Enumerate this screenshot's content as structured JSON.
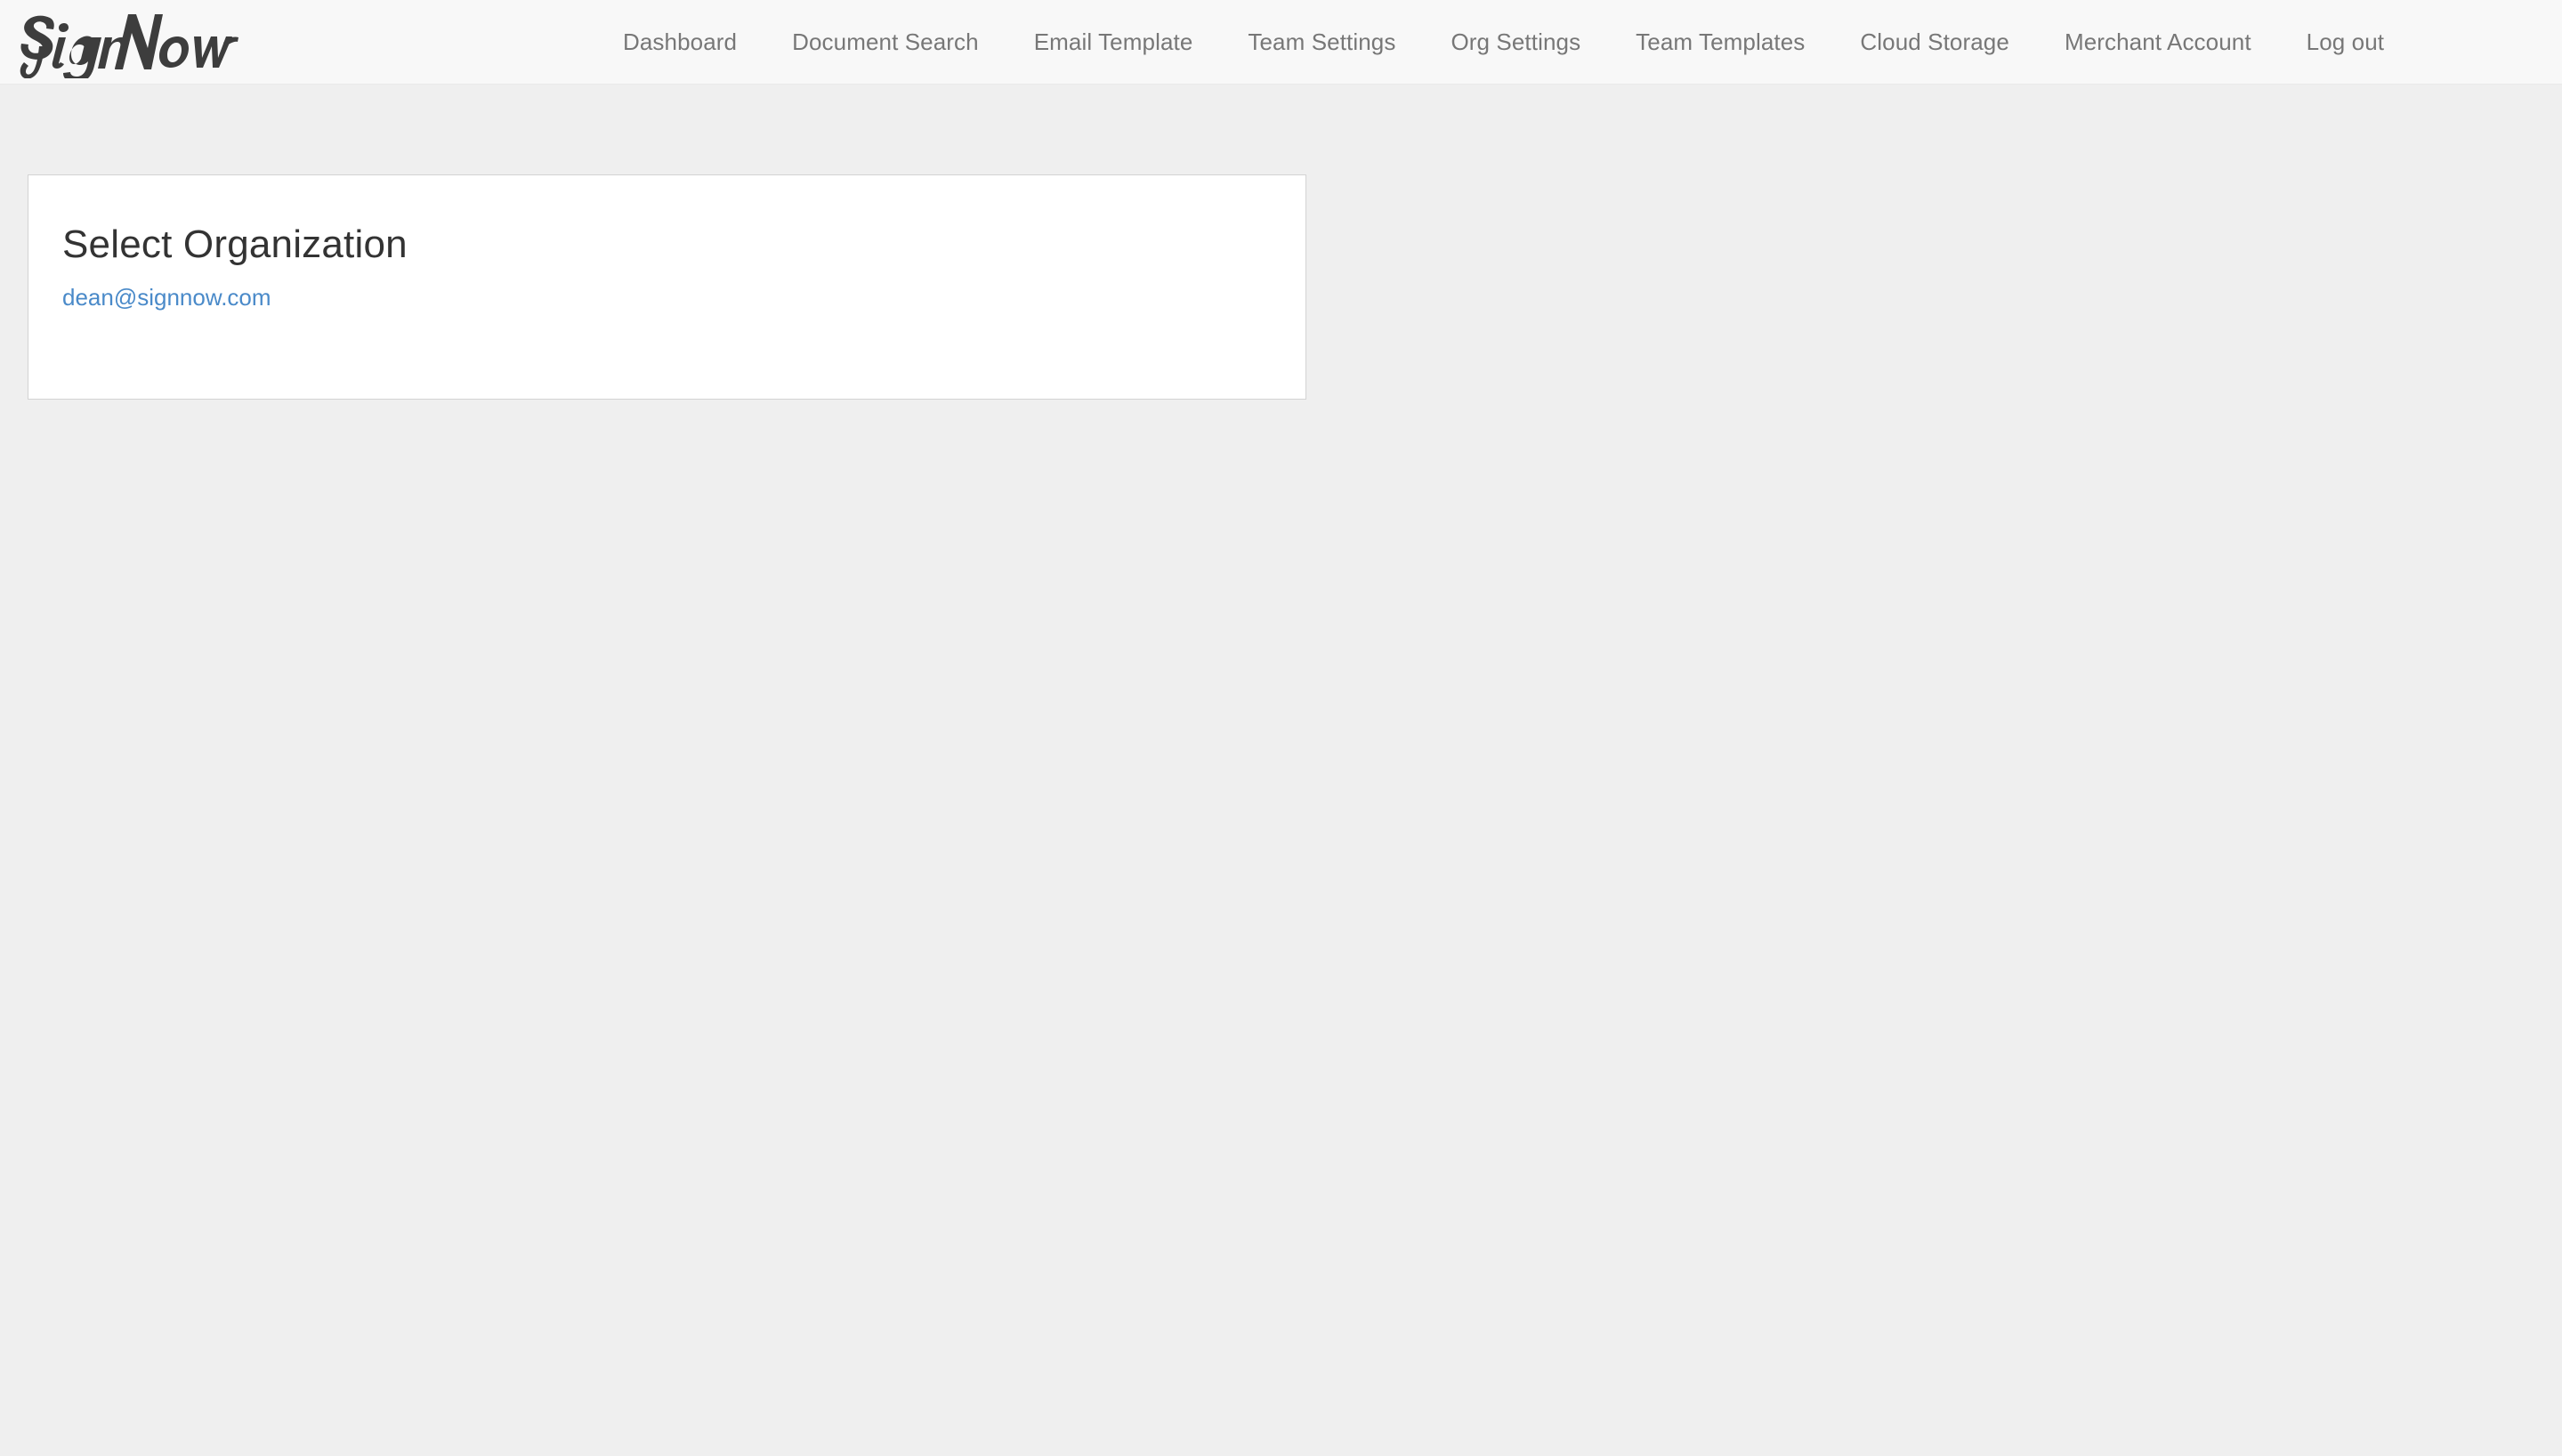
{
  "header": {
    "logo_text": "SignNow",
    "logo_icon": "signnow-script-logo",
    "nav_items": [
      {
        "label": "Dashboard",
        "name": "dashboard"
      },
      {
        "label": "Document Search",
        "name": "document-search"
      },
      {
        "label": "Email Template",
        "name": "email-template"
      },
      {
        "label": "Team Settings",
        "name": "team-settings"
      },
      {
        "label": "Org Settings",
        "name": "org-settings"
      },
      {
        "label": "Team Templates",
        "name": "team-templates"
      },
      {
        "label": "Cloud Storage",
        "name": "cloud-storage"
      },
      {
        "label": "Merchant Account",
        "name": "merchant-account"
      },
      {
        "label": "Log out",
        "name": "log-out"
      }
    ]
  },
  "main": {
    "card": {
      "title": "Select Organization",
      "organizations": [
        {
          "label": "dean@signnow.com"
        }
      ]
    }
  },
  "colors": {
    "page_background": "#efefef",
    "header_background": "#f8f8f8",
    "card_background": "#ffffff",
    "card_border": "#d3d3d3",
    "nav_text": "#777777",
    "title_text": "#333333",
    "link_blue": "#4a8ac9",
    "logo_dark": "#3d3d3d"
  }
}
